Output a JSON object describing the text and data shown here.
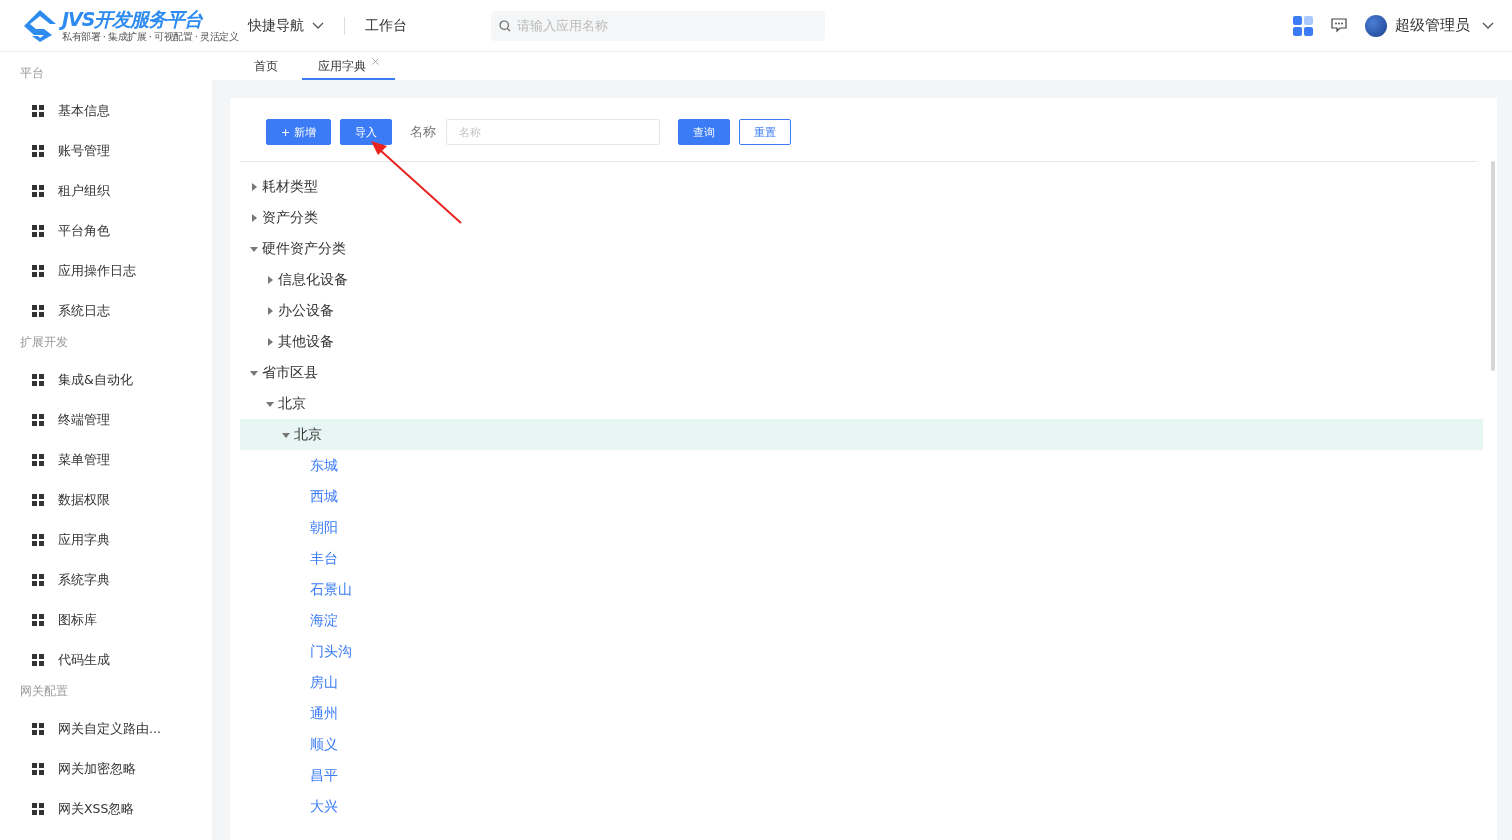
{
  "header": {
    "logo": {
      "title": "JVS开发服务平台",
      "slogan": "私有部署 · 集成扩展 · 可视配置 · 灵活定义"
    },
    "nav": [
      {
        "label": "快捷导航",
        "kind": "dropdown"
      },
      {
        "label": "工作台",
        "kind": "link"
      }
    ],
    "search": {
      "placeholder": "请输入应用名称"
    },
    "user": {
      "name": "超级管理员"
    }
  },
  "sidebar": {
    "sections": [
      {
        "title": "平台",
        "items": [
          {
            "label": "基本信息"
          },
          {
            "label": "账号管理"
          },
          {
            "label": "租户组织"
          },
          {
            "label": "平台角色"
          },
          {
            "label": "应用操作日志"
          },
          {
            "label": "系统日志"
          }
        ]
      },
      {
        "title": "扩展开发",
        "items": [
          {
            "label": "集成&自动化"
          },
          {
            "label": "终端管理"
          },
          {
            "label": "菜单管理"
          },
          {
            "label": "数据权限"
          },
          {
            "label": "应用字典"
          },
          {
            "label": "系统字典"
          },
          {
            "label": "图标库"
          },
          {
            "label": "代码生成"
          }
        ]
      },
      {
        "title": "网关配置",
        "items": [
          {
            "label": "网关自定义路由..."
          },
          {
            "label": "网关加密忽略"
          },
          {
            "label": "网关XSS忽略"
          }
        ]
      }
    ]
  },
  "tabs": [
    {
      "label": "首页",
      "selected": false,
      "closable": false
    },
    {
      "label": "应用字典",
      "selected": true,
      "closable": true
    }
  ],
  "toolbar": {
    "add_button": "+ 新增",
    "import_button": "导入",
    "filter_label": "名称",
    "filter_placeholder": "名称",
    "query_button": "查询",
    "reset_button": "重置"
  },
  "tree": [
    {
      "label": "耗材类型",
      "expanded": false,
      "selected": false
    },
    {
      "label": "资产分类",
      "expanded": false,
      "selected": false
    },
    {
      "label": "硬件资产分类",
      "expanded": true,
      "selected": false,
      "children": [
        {
          "label": "信息化设备",
          "expanded": false,
          "selected": false
        },
        {
          "label": "办公设备",
          "expanded": false,
          "selected": false
        },
        {
          "label": "其他设备",
          "expanded": false,
          "selected": false
        }
      ]
    },
    {
      "label": "省市区县",
      "expanded": true,
      "selected": false,
      "children": [
        {
          "label": "北京",
          "expanded": true,
          "selected": false,
          "children": [
            {
              "label": "北京",
              "expanded": true,
              "selected": true,
              "children": [
                {
                  "label": "东城",
                  "kind": "leaf",
                  "selected": false
                },
                {
                  "label": "西城",
                  "kind": "leaf",
                  "selected": false
                },
                {
                  "label": "朝阳",
                  "kind": "leaf",
                  "selected": false
                },
                {
                  "label": "丰台",
                  "kind": "leaf",
                  "selected": false
                },
                {
                  "label": "石景山",
                  "kind": "leaf",
                  "selected": false
                },
                {
                  "label": "海淀",
                  "kind": "leaf",
                  "selected": false
                },
                {
                  "label": "门头沟",
                  "kind": "leaf",
                  "selected": false
                },
                {
                  "label": "房山",
                  "kind": "leaf",
                  "selected": false
                },
                {
                  "label": "通州",
                  "kind": "leaf",
                  "selected": false
                },
                {
                  "label": "顺义",
                  "kind": "leaf",
                  "selected": false
                },
                {
                  "label": "昌平",
                  "kind": "leaf",
                  "selected": false
                },
                {
                  "label": "大兴",
                  "kind": "leaf",
                  "selected": false
                }
              ]
            }
          ]
        }
      ]
    }
  ]
}
